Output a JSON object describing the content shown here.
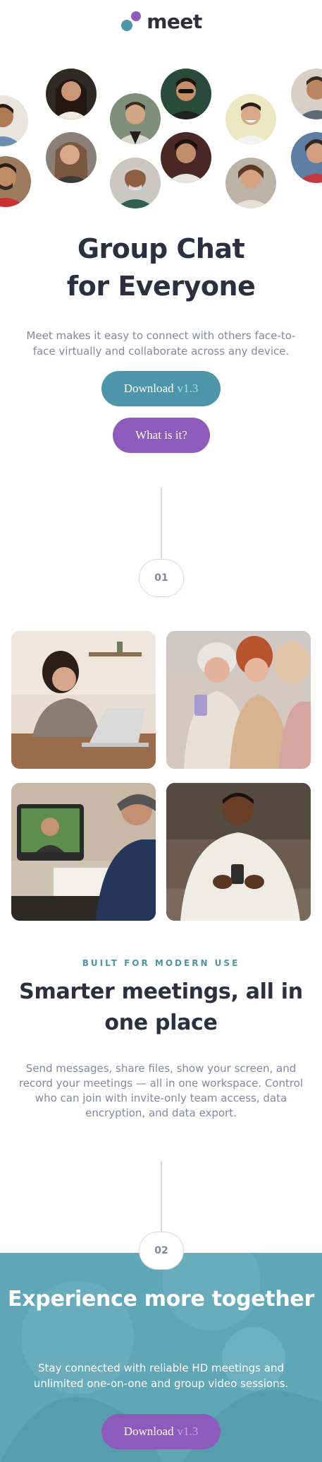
{
  "brand": {
    "name": "meet"
  },
  "hero": {
    "title_line1": "Group Chat",
    "title_line2": "for Everyone",
    "description": "Meet makes it easy to connect with others face-to-face virtually and collaborate across any device.",
    "download_label": "Download",
    "download_version": "v1.3",
    "what_label": "What is it?"
  },
  "steps": {
    "first": "01",
    "second": "02"
  },
  "features": {
    "eyebrow": "BUILT FOR MODERN USE",
    "title": "Smarter meetings, all in one place",
    "description": "Send messages, share files, show your screen, and record your meetings — all in one workspace. Control who can join with invite-only team access, data encryption, and data export."
  },
  "cta": {
    "title": "Experience more together",
    "description": "Stay connected with reliable HD meetings and unlimited one-on-one and group video sessions.",
    "download_label": "Download",
    "download_version": "v1.3"
  },
  "colors": {
    "accent_teal": "#4d96a9",
    "accent_purple": "#8d5bbc",
    "dark": "#2d2e3f",
    "muted": "#84889d"
  }
}
